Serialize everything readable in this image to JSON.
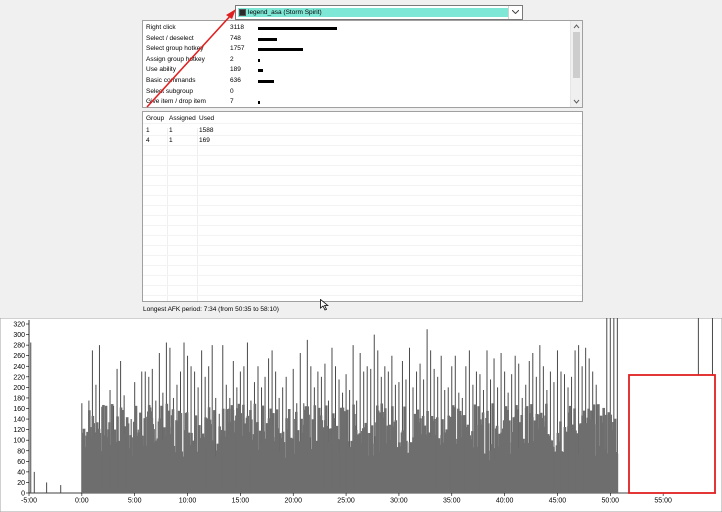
{
  "player_select": {
    "selected": "legend_asa (Storm Spirit)",
    "icon": "hero-icon"
  },
  "hotkeys": [
    {
      "name": "Right click",
      "count": "3118",
      "value": 3118
    },
    {
      "name": "Select / deselect",
      "count": "748",
      "value": 748
    },
    {
      "name": "Select group hotkey",
      "count": "1757",
      "value": 1757
    },
    {
      "name": "Assign group hotkey",
      "count": "2",
      "value": 2
    },
    {
      "name": "Use ability",
      "count": "189",
      "value": 189
    },
    {
      "name": "Basic commands",
      "count": "636",
      "value": 636
    },
    {
      "name": "Select subgroup",
      "count": "0",
      "value": 0
    },
    {
      "name": "Give item / drop item",
      "count": "7",
      "value": 7
    }
  ],
  "group_table": {
    "headers": [
      "Group",
      "Assigned",
      "Used"
    ],
    "rows": [
      [
        "1",
        "1",
        "1588"
      ],
      [
        "4",
        "1",
        "169"
      ]
    ]
  },
  "afk_text": "Longest AFK period: 7:34 (from 50:35 to 58:10)",
  "annotation_colors": {
    "arrow": "#e02020",
    "box": "#e02020"
  },
  "chart_data": {
    "type": "bar",
    "ylim": [
      0,
      320
    ],
    "yticks": [
      "0",
      "20",
      "40",
      "60",
      "80",
      "100",
      "120",
      "140",
      "160",
      "180",
      "200",
      "220",
      "240",
      "260",
      "280",
      "300",
      "320"
    ],
    "xlim": [
      -300,
      3600
    ],
    "xticks": [
      "-5:00",
      "0:00",
      "5:00",
      "10:00",
      "15:00",
      "20:00",
      "25:00",
      "30:00",
      "35:00",
      "40:00",
      "45:00",
      "50:00",
      "55:00"
    ],
    "bar_color": "#6e6e6e",
    "peaks": {
      "x_seconds": [
        -290,
        -270,
        -200,
        -120,
        0,
        40,
        60,
        80,
        100,
        120,
        140,
        160,
        180,
        200,
        220,
        240,
        260,
        280,
        300,
        320,
        340,
        360,
        380,
        400,
        420,
        440,
        460,
        480,
        500,
        520,
        540,
        560,
        580,
        600,
        620,
        640,
        660,
        680,
        700,
        720,
        740,
        760,
        780,
        800,
        820,
        840,
        860,
        880,
        900,
        920,
        940,
        960,
        980,
        1000,
        1020,
        1040,
        1060,
        1080,
        1100,
        1120,
        1140,
        1160,
        1180,
        1200,
        1220,
        1240,
        1260,
        1280,
        1300,
        1320,
        1340,
        1360,
        1380,
        1400,
        1420,
        1440,
        1460,
        1480,
        1500,
        1520,
        1540,
        1560,
        1580,
        1600,
        1620,
        1640,
        1660,
        1680,
        1700,
        1720,
        1740,
        1760,
        1780,
        1800,
        1820,
        1840,
        1860,
        1880,
        1900,
        1920,
        1940,
        1960,
        1980,
        2000,
        2020,
        2040,
        2060,
        2080,
        2100,
        2120,
        2140,
        2160,
        2180,
        2200,
        2220,
        2240,
        2260,
        2280,
        2300,
        2320,
        2340,
        2360,
        2380,
        2400,
        2420,
        2440,
        2460,
        2480,
        2500,
        2520,
        2540,
        2560,
        2580,
        2600,
        2620,
        2640,
        2660,
        2680,
        2700,
        2720,
        2740,
        2760,
        2780,
        2800,
        2820,
        2840,
        2860,
        2880,
        2900,
        2920,
        2940,
        2960,
        2980,
        3000,
        3020,
        3040,
        3500,
        3580
      ],
      "values": [
        285,
        40,
        20,
        15,
        170,
        175,
        270,
        205,
        280,
        150,
        155,
        195,
        165,
        235,
        250,
        185,
        130,
        140,
        210,
        120,
        230,
        230,
        220,
        235,
        175,
        265,
        190,
        285,
        275,
        180,
        205,
        230,
        285,
        260,
        240,
        230,
        200,
        270,
        220,
        240,
        280,
        180,
        150,
        280,
        205,
        180,
        250,
        200,
        230,
        240,
        285,
        175,
        210,
        240,
        200,
        220,
        255,
        270,
        230,
        180,
        200,
        220,
        150,
        235,
        170,
        265,
        170,
        290,
        240,
        200,
        230,
        220,
        245,
        175,
        275,
        240,
        215,
        190,
        225,
        195,
        280,
        175,
        265,
        230,
        240,
        235,
        300,
        270,
        220,
        240,
        230,
        260,
        205,
        210,
        250,
        215,
        275,
        200,
        230,
        245,
        215,
        310,
        270,
        235,
        220,
        260,
        195,
        200,
        240,
        260,
        190,
        180,
        240,
        270,
        205,
        230,
        225,
        195,
        270,
        215,
        255,
        200,
        265,
        230,
        190,
        225,
        260,
        245,
        180,
        205,
        250,
        265,
        220,
        280,
        240,
        195,
        230,
        210,
        270,
        230,
        225,
        200,
        220,
        270,
        280,
        240,
        275,
        255,
        230,
        205,
        15,
        10
      ]
    }
  }
}
